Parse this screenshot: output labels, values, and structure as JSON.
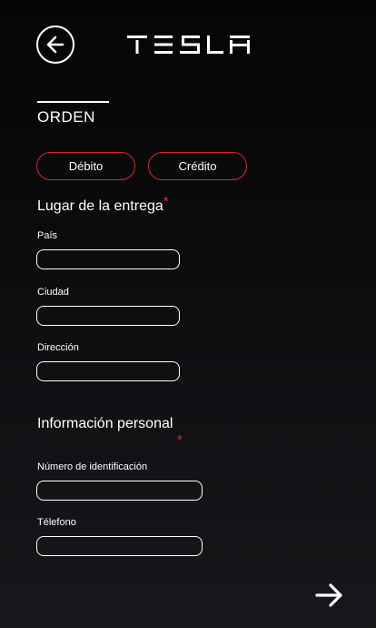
{
  "header": {
    "back_icon": "arrow-left-circle-icon",
    "logo": "TESLA"
  },
  "tab": {
    "label": "ORDEN"
  },
  "payment": {
    "options": [
      {
        "label": "Débito"
      },
      {
        "label": "Crédito"
      }
    ],
    "accent_color": "#e0262a"
  },
  "delivery": {
    "title": "Lugar de la entrega",
    "required_mark": "*",
    "fields": [
      {
        "label": "País",
        "value": "",
        "placeholder": ""
      },
      {
        "label": "Ciudad",
        "value": "",
        "placeholder": ""
      },
      {
        "label": "Dirección",
        "value": "",
        "placeholder": ""
      }
    ]
  },
  "personal": {
    "title": "Información personal",
    "required_mark": "*",
    "fields": [
      {
        "label": "Número de identificación",
        "value": "",
        "placeholder": ""
      },
      {
        "label": "Télefono",
        "value": "",
        "placeholder": ""
      }
    ]
  },
  "footer": {
    "next_icon": "arrow-right-icon"
  }
}
